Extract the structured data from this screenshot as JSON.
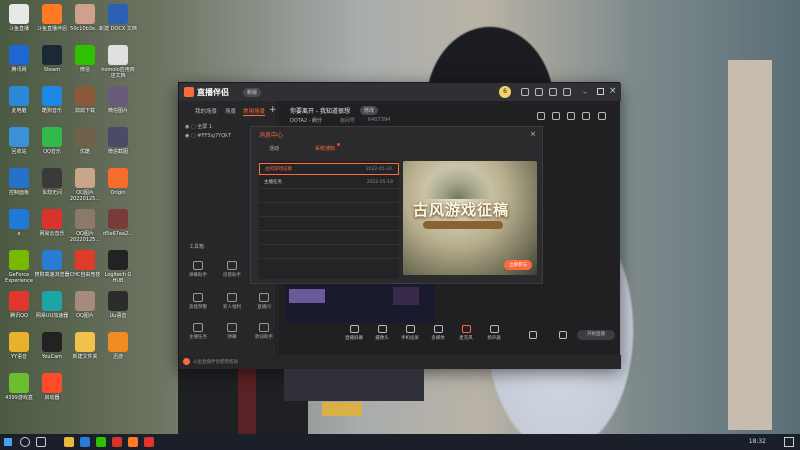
{
  "desktop_icons": [
    {
      "label": "斗鱼直播",
      "color": "#e8e8e8"
    },
    {
      "label": "斗鱼直播伴侣",
      "color": "#ff7a22"
    },
    {
      "label": "50c10b3e...",
      "color": "#cfa08a"
    },
    {
      "label": "新建 DOCX 文档",
      "color": "#2a5fb3"
    },
    {
      "label": "腾讯网",
      "color": "#1e66d0"
    },
    {
      "label": "Steam",
      "color": "#1b2838"
    },
    {
      "label": "微信",
      "color": "#2dc100"
    },
    {
      "label": "homolo应用商店文档",
      "color": "#e0e0e0"
    },
    {
      "label": "此电脑",
      "color": "#2c89d8"
    },
    {
      "label": "酷狗音乐",
      "color": "#1e88e5"
    },
    {
      "label": "鼎鼎下载",
      "color": "#8a5a3a"
    },
    {
      "label": "微信图片",
      "color": "#6a5b7a"
    },
    {
      "label": "回收站",
      "color": "#3b90d8"
    },
    {
      "label": "QQ音乐",
      "color": "#33b94a"
    },
    {
      "label": "优酷",
      "color": "#6f6248"
    },
    {
      "label": "微信截图",
      "color": "#4b4b66"
    },
    {
      "label": "控制面板",
      "color": "#2572c9"
    },
    {
      "label": "永劫无间",
      "color": "#3a3a3a"
    },
    {
      "label": "QQ图片20220125...",
      "color": "#c9a58a"
    },
    {
      "label": "Origin",
      "color": "#f56c2d"
    },
    {
      "label": "e",
      "color": "#1e7ad6"
    },
    {
      "label": "网易云音乐",
      "color": "#d9332c"
    },
    {
      "label": "QQ图片20220125...",
      "color": "#8b7a6a"
    },
    {
      "label": "d5e67ea2...",
      "color": "#7a3a3a"
    },
    {
      "label": "GeForce Experience",
      "color": "#76b900"
    },
    {
      "label": "搜狗高速浏览器",
      "color": "#2a7bd3"
    },
    {
      "label": "CHC自由竞技",
      "color": "#e23a2a"
    },
    {
      "label": "Logitech G HUB",
      "color": "#222"
    },
    {
      "label": "腾讯QQ",
      "color": "#e2352e"
    },
    {
      "label": "网易UU加速器",
      "color": "#1ea4a4"
    },
    {
      "label": "QQ图片",
      "color": "#a88a7a"
    },
    {
      "label": "Uu语音",
      "color": "#2c2c2c"
    },
    {
      "label": "YY语音",
      "color": "#e8b12a"
    },
    {
      "label": "YouCam",
      "color": "#222"
    },
    {
      "label": "新建文件夹",
      "color": "#f1c14c"
    },
    {
      "label": "迅游",
      "color": "#f28b20"
    },
    {
      "label": "4399游戏盒",
      "color": "#6bbf2f"
    },
    {
      "label": "启动器",
      "color": "#ff4b2a"
    }
  ],
  "app": {
    "logo": "直播伴侣",
    "version_tag": "新版",
    "left_tabs": [
      "我的场景",
      "场景",
      "常用场景"
    ],
    "add": "+",
    "room_title": "你要离开 - 我知道很想",
    "room_tag": "修改",
    "room_meta": [
      "DOTA2 - 刷分",
      "房间号",
      "6407394"
    ],
    "user_level": "6",
    "sources": [
      {
        "label": "全屏 1"
      },
      {
        "label": "#FF5ig7YQkT"
      }
    ],
    "tools_title": "工具箱",
    "tools": [
      {
        "label": "弹幕助手"
      },
      {
        "label": "房管助手"
      },
      {
        "label": "高能预警"
      },
      {
        "label": "新人福利"
      },
      {
        "label": "直播间"
      },
      {
        "label": "主播任务"
      },
      {
        "label": "弹幕"
      },
      {
        "label": "歌词助手"
      }
    ],
    "controls": [
      {
        "label": "直播屏幕"
      },
      {
        "label": "摄像头"
      },
      {
        "label": "手机投屏"
      },
      {
        "label": "多媒体"
      },
      {
        "label": "麦克风"
      },
      {
        "label": "扬声器"
      }
    ],
    "start_live": "开始直播",
    "status_left": "斗鱼直播伴侣使用帮助"
  },
  "dialog": {
    "title": "消息中心",
    "close": "×",
    "tabs": [
      "活动",
      "系统通知"
    ],
    "rows": [
      {
        "name": "古风游戏征稿",
        "date": "2022-05-24",
        "selected": true
      },
      {
        "name": "主播任务",
        "date": "2022-05-18",
        "selected": false
      }
    ],
    "banner_title": "古风游戏征稿",
    "banner_button": "立即参与"
  },
  "taskbar": {
    "time": "18:32"
  },
  "colors": {
    "accent": "#ff6a3d",
    "window_bg": "#2c2c2f",
    "taskbar": "#1b1f2a"
  }
}
